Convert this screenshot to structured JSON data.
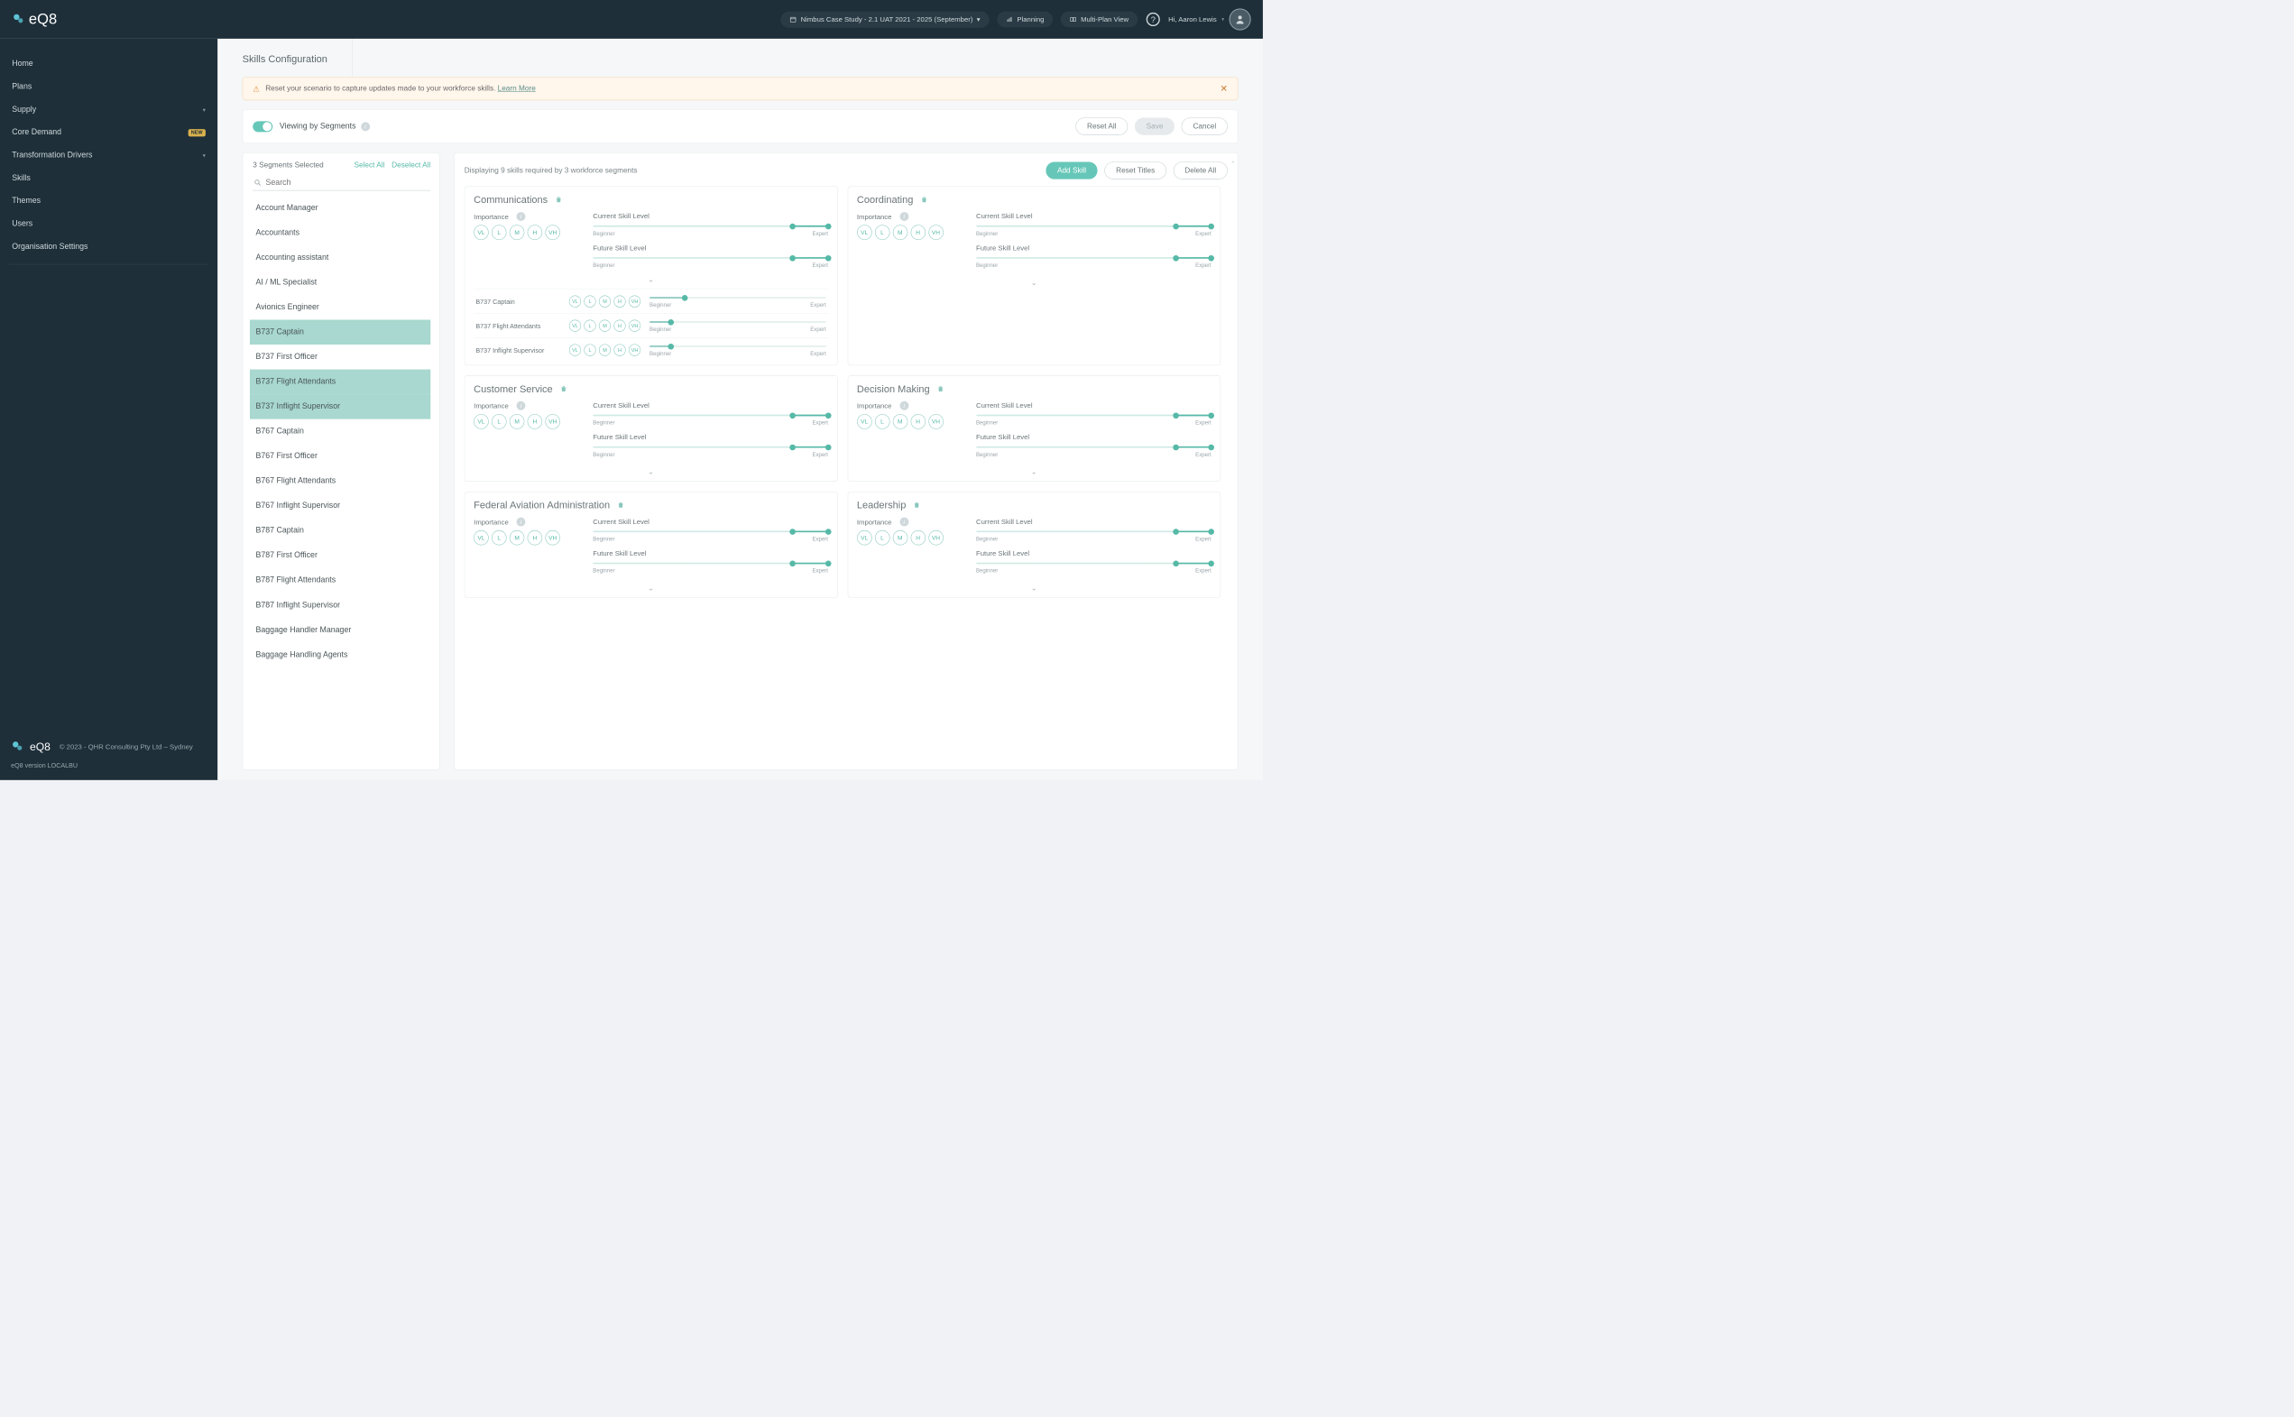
{
  "brand": "eQ8",
  "header": {
    "case_study": "Nimbus Case Study - 2.1 UAT 2021 - 2025 (September)",
    "planning": "Planning",
    "multi": "Multi-Plan View",
    "greeting": "Hi, Aaron Lewis"
  },
  "nav": {
    "items": [
      "Home",
      "Plans",
      "Supply",
      "Core Demand",
      "Transformation Drivers",
      "Skills",
      "Themes",
      "Users",
      "Organisation Settings"
    ],
    "new_badge": "NEW"
  },
  "footer": {
    "copyright": "© 2023 - QHR Consulting Pty Ltd – Sydney",
    "version": "eQ8 version LOCALBU"
  },
  "page_title": "Skills Configuration",
  "alert": {
    "text": "Reset your scenario to capture updates made to your workforce skills.",
    "learn": "Learn More"
  },
  "toolbar": {
    "view_label": "Viewing by Segments",
    "reset_all": "Reset All",
    "save": "Save",
    "cancel": "Cancel"
  },
  "segments": {
    "count_label": "3 Segments Selected",
    "select_all": "Select All",
    "deselect_all": "Deselect All",
    "search_placeholder": "Search",
    "items": [
      {
        "label": "Account Manager",
        "selected": false
      },
      {
        "label": "Accountants",
        "selected": false
      },
      {
        "label": "Accounting assistant",
        "selected": false
      },
      {
        "label": "AI / ML Specialist",
        "selected": false
      },
      {
        "label": "Avionics Engineer",
        "selected": false
      },
      {
        "label": "B737 Captain",
        "selected": true
      },
      {
        "label": "B737 First Officer",
        "selected": false
      },
      {
        "label": "B737 Flight Attendants",
        "selected": true
      },
      {
        "label": "B737 Inflight Supervisor",
        "selected": true
      },
      {
        "label": "B767 Captain",
        "selected": false
      },
      {
        "label": "B767 First Officer",
        "selected": false
      },
      {
        "label": "B767 Flight Attendants",
        "selected": false
      },
      {
        "label": "B767 Inflight Supervisor",
        "selected": false
      },
      {
        "label": "B787 Captain",
        "selected": false
      },
      {
        "label": "B787 First Officer",
        "selected": false
      },
      {
        "label": "B787 Flight Attendants",
        "selected": false
      },
      {
        "label": "B787 Inflight Supervisor",
        "selected": false
      },
      {
        "label": "Baggage Handler Manager",
        "selected": false
      },
      {
        "label": "Baggage Handling Agents",
        "selected": false
      }
    ]
  },
  "right": {
    "summary": "Displaying 9 skills required by 3 workforce segments",
    "add_skill": "Add Skill",
    "reset_titles": "Reset Titles",
    "delete_all": "Delete All",
    "importance_label": "Importance",
    "current_label": "Current Skill Level",
    "future_label": "Future Skill Level",
    "beginner": "Beginner",
    "expert": "Expert",
    "pills": [
      "VL",
      "L",
      "M",
      "H",
      "VH"
    ],
    "skills": [
      {
        "title": "Communications",
        "expanded": true,
        "current": [
          85,
          100
        ],
        "future": [
          85,
          100
        ],
        "details": [
          {
            "name": "B737 Captain",
            "slider": 20
          },
          {
            "name": "B737 Flight Attendants",
            "slider": 12
          },
          {
            "name": "B737 Inflight Supervisor",
            "slider": 12
          }
        ]
      },
      {
        "title": "Coordinating",
        "expanded": false,
        "current": [
          85,
          100
        ],
        "future": [
          85,
          100
        ]
      },
      {
        "title": "Customer Service",
        "expanded": false,
        "current": [
          85,
          100
        ],
        "future": [
          85,
          100
        ]
      },
      {
        "title": "Decision Making",
        "expanded": false,
        "current": [
          85,
          100
        ],
        "future": [
          85,
          100
        ]
      },
      {
        "title": "Federal Aviation Administration",
        "expanded": false,
        "current": [
          85,
          100
        ],
        "future": [
          85,
          100
        ]
      },
      {
        "title": "Leadership",
        "expanded": false,
        "current": [
          85,
          100
        ],
        "future": [
          85,
          100
        ]
      }
    ]
  }
}
